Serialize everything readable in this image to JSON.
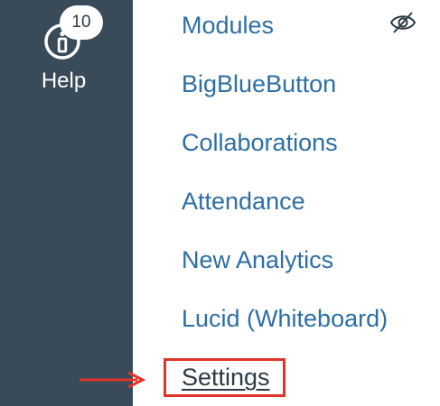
{
  "global_nav": {
    "help": {
      "label": "Help",
      "badge_count": "10"
    }
  },
  "course_nav": {
    "items": [
      {
        "label": "Modules",
        "hidden": true
      },
      {
        "label": "BigBlueButton"
      },
      {
        "label": "Collaborations"
      },
      {
        "label": "Attendance"
      },
      {
        "label": "New Analytics"
      },
      {
        "label": "Lucid (Whiteboard)"
      },
      {
        "label": "Settings",
        "active": true
      }
    ]
  },
  "annotation": {
    "highlight_color": "#e0342a",
    "target": "Settings"
  },
  "colors": {
    "global_nav_bg": "#394b58",
    "link": "#2d6ea5",
    "active_link": "#2d3b45"
  },
  "icons": {
    "help": "info-circle-icon",
    "hidden": "eye-slash-icon"
  }
}
